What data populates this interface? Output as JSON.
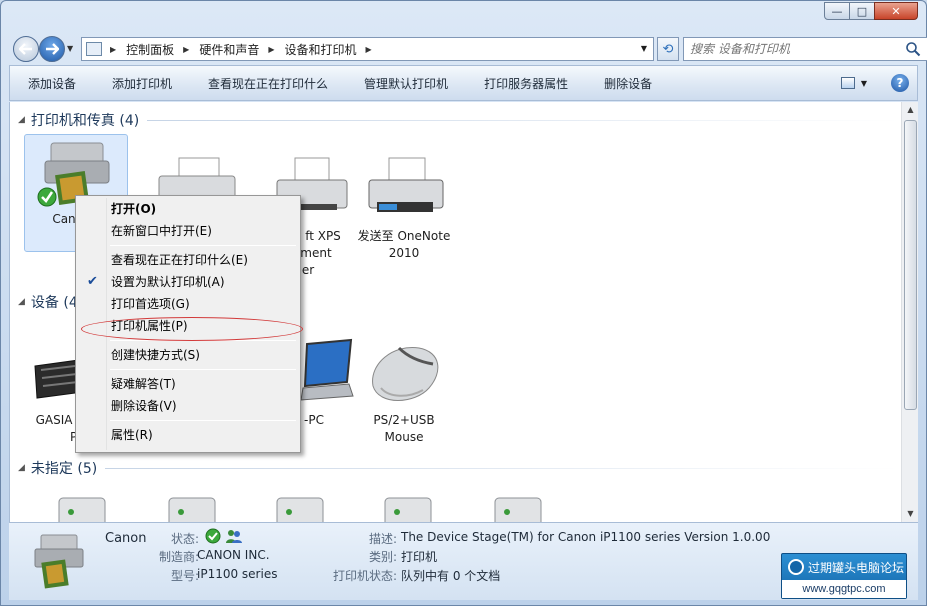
{
  "window": {
    "controls": {
      "minimize": "—",
      "maximize": "□",
      "close": "✕"
    }
  },
  "address_bar": {
    "breadcrumbs": [
      {
        "label": "控制面板"
      },
      {
        "label": "硬件和声音"
      },
      {
        "label": "设备和打印机"
      }
    ],
    "search_placeholder": "搜索 设备和打印机"
  },
  "toolbar": {
    "items": [
      {
        "label": "添加设备"
      },
      {
        "label": "添加打印机"
      },
      {
        "label": "查看现在正在打印什么"
      },
      {
        "label": "管理默认打印机"
      },
      {
        "label": "打印服务器属性"
      },
      {
        "label": "删除设备"
      }
    ],
    "help": "?"
  },
  "groups": {
    "printers": {
      "header": "打印机和传真 (4)",
      "items": [
        {
          "label": "Can"
        },
        {
          "label": ""
        },
        {
          "label_lines": [
            "ft XPS",
            "ment",
            "er"
          ]
        },
        {
          "label_lines": [
            "发送至 OneNote",
            "2010"
          ]
        }
      ]
    },
    "devices": {
      "header": "设备 (4",
      "items": [
        {
          "label_lines": [
            "GASIA",
            "Pr"
          ]
        },
        {
          "label": "-PC"
        },
        {
          "label_lines": [
            "PS/2+USB",
            "Mouse"
          ]
        }
      ]
    },
    "unspecified": {
      "header": "未指定 (5)"
    }
  },
  "context_menu": {
    "items": [
      {
        "label": "打开(O)",
        "bold": true
      },
      {
        "label": "在新窗口中打开(E)"
      },
      {
        "label": "查看现在正在打印什么(E)"
      },
      {
        "label": "设置为默认打印机(A)",
        "checked": true
      },
      {
        "label": "打印首选项(G)"
      },
      {
        "label": "打印机属性(P)",
        "highlighted_oval": true
      },
      {
        "label": "创建快捷方式(S)"
      },
      {
        "label": "疑难解答(T)"
      },
      {
        "label": "删除设备(V)"
      },
      {
        "label": "属性(R)"
      }
    ],
    "check_mark": "✔"
  },
  "details_pane": {
    "name": "Canon",
    "status_label": "状态:",
    "manufacturer_label": "制造商:",
    "manufacturer": "CANON INC.",
    "model_label": "型号:",
    "model": "iP1100 series",
    "description_label": "描述:",
    "description": "The Device Stage(TM) for Canon iP1100 series Version 1.0.00",
    "category_label": "类别:",
    "category": "打印机",
    "printer_status_label": "打印机状态:",
    "printer_status": "队列中有 0 个文档"
  },
  "watermark": {
    "top": "过期罐头电脑论坛",
    "bottom": "www.gqgtpc.com"
  }
}
